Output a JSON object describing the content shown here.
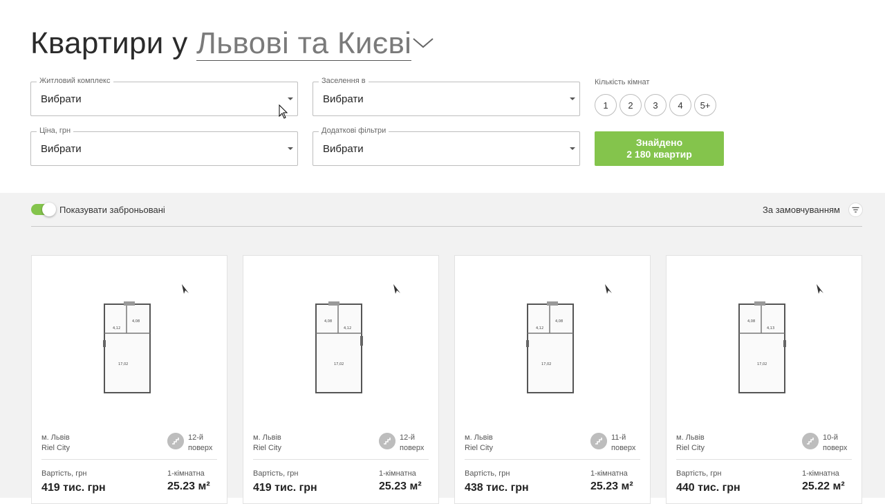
{
  "header": {
    "title_prefix": "Квартири у",
    "title_city": "Львові та Києві"
  },
  "filters": {
    "complex": {
      "label": "Житловий комплекс",
      "value": "Вибрати"
    },
    "settle": {
      "label": "Заселення в",
      "value": "Вибрати"
    },
    "price": {
      "label": "Ціна, грн",
      "value": "Вибрати"
    },
    "extra": {
      "label": "Додаткові фільтри",
      "value": "Вибрати"
    },
    "rooms_label": "Кількість кімнат",
    "rooms": [
      "1",
      "2",
      "3",
      "4",
      "5+"
    ],
    "found_line1": "Знайдено",
    "found_line2": "2 180 квартир"
  },
  "list": {
    "show_reserved_label": "Показувати заброньовані",
    "show_reserved_on": true,
    "sort_label": "За замовчуванням"
  },
  "cards": [
    {
      "city": "м. Львів",
      "complex": "Riel City",
      "floor": "12-й",
      "floor_word": "поверх",
      "price_label": "Вартість, грн",
      "price": "419 тис. грн",
      "rooms": "1-кімнатна",
      "area": "25.23 м²"
    },
    {
      "city": "м. Львів",
      "complex": "Riel City",
      "floor": "12-й",
      "floor_word": "поверх",
      "price_label": "Вартість, грн",
      "price": "419 тис. грн",
      "rooms": "1-кімнатна",
      "area": "25.23 м²"
    },
    {
      "city": "м. Львів",
      "complex": "Riel City",
      "floor": "11-й",
      "floor_word": "поверх",
      "price_label": "Вартість, грн",
      "price": "438 тис. грн",
      "rooms": "1-кімнатна",
      "area": "25.23 м²"
    },
    {
      "city": "м. Львів",
      "complex": "Riel City",
      "floor": "10-й",
      "floor_word": "поверх",
      "price_label": "Вартість, грн",
      "price": "440 тис. грн",
      "rooms": "1-кімнатна",
      "area": "25.22 м²"
    }
  ],
  "colors": {
    "accent": "#84c44c",
    "background_list": "#f2f2f2"
  }
}
